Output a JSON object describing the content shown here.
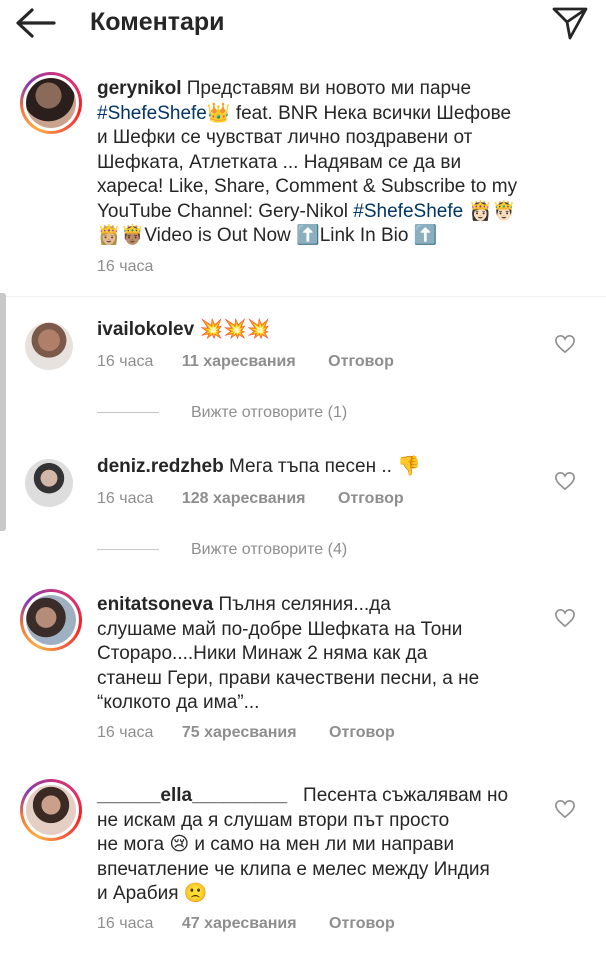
{
  "header": {
    "title": "Коментари",
    "back_icon": "arrow-left-icon",
    "send_icon": "paper-plane-icon"
  },
  "caption": {
    "user": "gerynikol",
    "line1": "Представям ви новото ми парче",
    "tag1": "#ShefeShefe",
    "emoji1": "👑",
    "line2": " feat. BNR  Нека всички Шефове",
    "line3": "и Шефки се чувстват лично поздравени от",
    "line4": "Шефката, Атлетката ... Надявам се да ви",
    "line5": "хареса!  Like, Share, Comment & Subscribe to my",
    "line6a": "YouTube Channel: Gery-Nikol  ",
    "tag2": "#ShefeShefe",
    "emoji2": " 👸🏻🤴🏻",
    "line7": "👸🏼🤴🏽Video is Out Now ⬆️Link In Bio ⬆️",
    "time": "16 часа"
  },
  "comments": [
    {
      "user": "ivailokolev",
      "text": "💥💥💥",
      "time": "16 часа",
      "likes": "11 харесвания",
      "reply": "Отговор"
    },
    {
      "user": "deniz.redzheb",
      "text": "Мега тъпа песен .. 👎",
      "time": "16 часа",
      "likes": "128 харесвания",
      "reply": "Отговор"
    },
    {
      "user": "enitatsoneva",
      "line1": "Пълня селяния...да",
      "line2": "слушаме май по-добре Шефката на Тони",
      "line3": "Стораро....Ники Минаж 2 няма как да",
      "line4": "станеш Гери, прави качествени песни, а не",
      "line5": "“колкото да има”...",
      "time": "16 часа",
      "likes": "75 харесвания",
      "reply": "Отговор"
    },
    {
      "user": "______ella_________",
      "line1": "Песента съжалявам но",
      "line2": "не искам да я слушам втори път просто",
      "line3": "не мога 😢 и само на мен ли ми направи",
      "line4": "впечатление че клипа е мелес между Индия",
      "line5": "и Арабия 🙁",
      "time": "16 часа",
      "likes": "47 харесвания",
      "reply": "Отговор"
    }
  ],
  "view_replies": [
    "Вижте отговорите (1)",
    "Вижте отговорите (4)"
  ],
  "colors": {
    "hashtag": "#003569",
    "meta": "#8e8e8e",
    "text": "#262626"
  }
}
